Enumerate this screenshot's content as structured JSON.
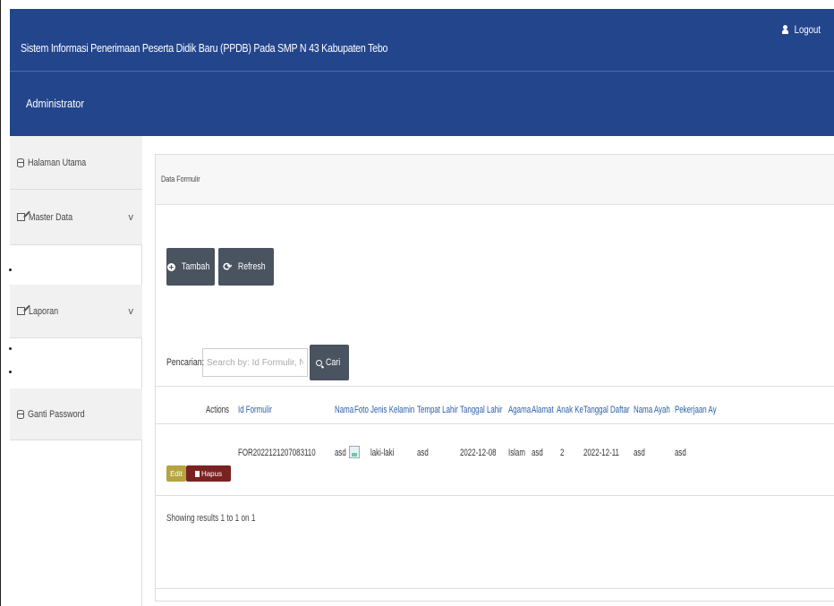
{
  "header": {
    "title": "Sistem Informasi Penerimaan Peserta Didik Baru (PPDB) Pada SMP N 43 Kabupaten Tebo",
    "logout_label": "Logout",
    "role_label": "Administrator",
    "background_color": "#23458c"
  },
  "sidebar": {
    "items": [
      {
        "label": "Halaman Utama",
        "icon": "database-icon"
      },
      {
        "label": "Master Data",
        "icon": "edit-icon",
        "chevron": "v"
      },
      {
        "label": "Laporan",
        "icon": "edit-icon",
        "chevron": "v"
      },
      {
        "label": "Ganti Password",
        "icon": "database-icon"
      }
    ]
  },
  "panel": {
    "title": "Data Formulir",
    "tambah_label": "Tambah",
    "refresh_label": "Refresh",
    "search_label": "Pencarian:",
    "search_placeholder": "Search by: Id Formulir, Nam",
    "cari_label": "Cari"
  },
  "table": {
    "columns": [
      "Actions",
      "Id Formulir",
      "Nama",
      "Foto",
      "Jenis Kelamin",
      "Tempat Lahir",
      "Tanggal Lahir",
      "Agama",
      "Alamat",
      "Anak Ke",
      "Tanggal Daftar",
      "Nama Ayah",
      "Pekerjaan Ay"
    ],
    "rows": [
      {
        "edit_label": "Edit",
        "hapus_label": "Hapus",
        "id_formulir": "FOR2022121207083110",
        "nama": "asd",
        "jenis_kelamin": "laki-laki",
        "tempat_lahir": "asd",
        "tanggal_lahir": "2022-12-08",
        "agama": "Islam",
        "alamat": "asd",
        "anak_ke": "2",
        "tanggal_daftar": "2022-12-11",
        "nama_ayah": "asd",
        "pekerjaan_ayah": "asd"
      }
    ],
    "showing": "Showing results 1 to 1 on 1"
  }
}
